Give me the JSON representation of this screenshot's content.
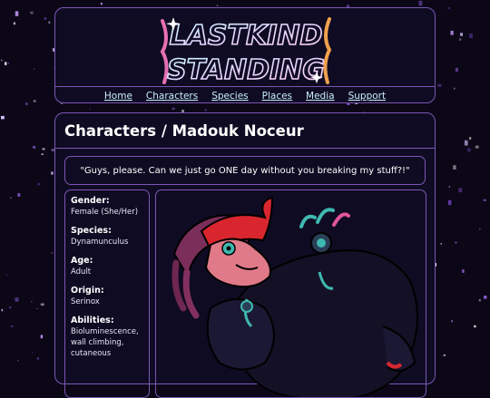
{
  "site": {
    "logo_text_line1": "LASTKIND",
    "logo_text_line2": "STANDING"
  },
  "nav": {
    "items": [
      "Home",
      "Characters",
      "Species",
      "Places",
      "Media",
      "Support"
    ]
  },
  "page": {
    "title": "Characters / Madouk Noceur",
    "quote": "\"Guys, please. Can we just go ONE day without you breaking my stuff?!\""
  },
  "info": {
    "fields": [
      {
        "label": "Gender:",
        "value": "Female (She/Her)"
      },
      {
        "label": "Species:",
        "value": "Dynamunculus"
      },
      {
        "label": "Age:",
        "value": "Adult"
      },
      {
        "label": "Origin:",
        "value": "Serinox"
      },
      {
        "label": "Abilities:",
        "value": "Bioluminescence, wall climbing, cutaneous"
      }
    ]
  },
  "colors": {
    "background": "#0b0717",
    "panel": "#0f0b22",
    "border": "#7b57b5",
    "nav_link": "#c9f0ff",
    "accent_pink": "#e0559c",
    "accent_red": "#d9262e",
    "accent_teal": "#3fb8b0"
  }
}
